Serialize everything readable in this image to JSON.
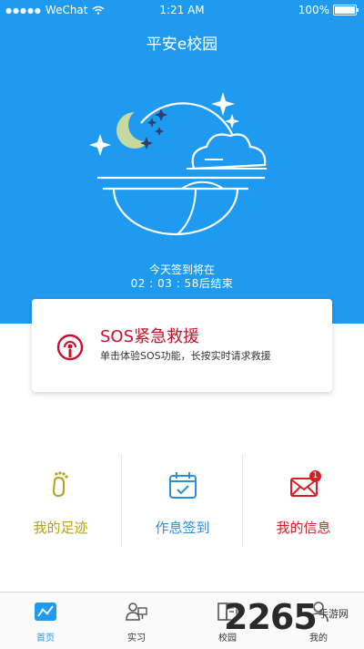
{
  "status_bar": {
    "signal": "●●●●●",
    "carrier": "WeChat",
    "wifi_icon": "wifi-icon",
    "time": "1:21 AM",
    "battery_percent": "100%",
    "battery_level": 1.0
  },
  "header": {
    "title": "平安e校园"
  },
  "checkin": {
    "line1": "今天签到将在",
    "line2": "02 : 03 : 58后结束"
  },
  "sos": {
    "title": "SOS紧急救援",
    "description": "单击体验SOS功能，长按实时请求救援",
    "icon": "sos-alarm-icon",
    "color": "#c8102e"
  },
  "features": [
    {
      "label": "我的足迹",
      "icon": "footprint-icon",
      "color": "#b5a219"
    },
    {
      "label": "作息签到",
      "icon": "calendar-check-icon",
      "color": "#2a8fd8"
    },
    {
      "label": "我的信息",
      "icon": "mail-icon",
      "color": "#d71f28",
      "badge": "1"
    }
  ],
  "tabs": [
    {
      "label": "首页",
      "icon": "home-chart-icon",
      "active": true
    },
    {
      "label": "实习",
      "icon": "internship-icon",
      "active": false
    },
    {
      "label": "校园",
      "icon": "campus-icon",
      "active": false
    },
    {
      "label": "我的",
      "icon": "user-icon",
      "active": false
    }
  ],
  "watermark": {
    "number": "2265",
    "text": "手游网"
  },
  "colors": {
    "primary": "#1e9bf0",
    "accent_red": "#c8102e",
    "background": "#ffffff"
  }
}
